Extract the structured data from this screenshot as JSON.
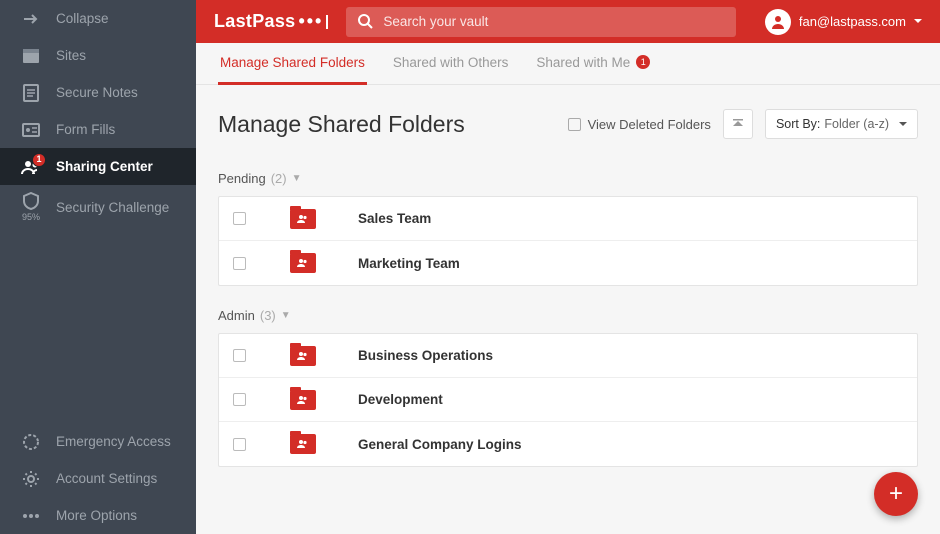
{
  "brand": "LastPass",
  "search": {
    "placeholder": "Search your vault"
  },
  "user": {
    "email": "fan@lastpass.com"
  },
  "sidebar": {
    "collapse": "Collapse",
    "items": [
      {
        "label": "Sites"
      },
      {
        "label": "Secure Notes"
      },
      {
        "label": "Form Fills"
      },
      {
        "label": "Sharing Center",
        "badge": "1"
      },
      {
        "label": "Security Challenge",
        "sub": "95%"
      }
    ],
    "bottom": [
      {
        "label": "Emergency Access"
      },
      {
        "label": "Account Settings"
      },
      {
        "label": "More Options"
      }
    ]
  },
  "tabs": [
    {
      "label": "Manage Shared Folders",
      "active": true
    },
    {
      "label": "Shared with Others"
    },
    {
      "label": "Shared with Me",
      "badge": "1"
    }
  ],
  "page": {
    "title": "Manage Shared Folders",
    "view_deleted": "View Deleted Folders",
    "sort_label": "Sort By:",
    "sort_value": "Folder (a-z)"
  },
  "sections": [
    {
      "name": "Pending",
      "count": "(2)",
      "folders": [
        "Sales Team",
        "Marketing Team"
      ]
    },
    {
      "name": "Admin",
      "count": "(3)",
      "folders": [
        "Business Operations",
        "Development",
        "General Company Logins"
      ]
    }
  ]
}
